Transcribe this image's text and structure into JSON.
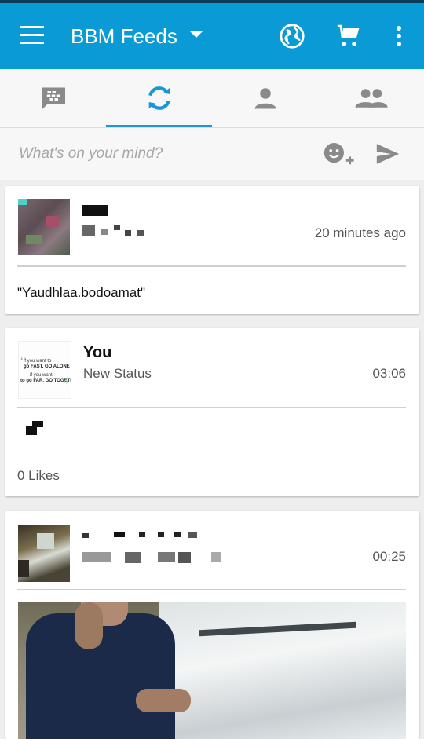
{
  "app": {
    "title": "BBM Feeds"
  },
  "composer": {
    "placeholder": "What's on your mind?"
  },
  "posts": [
    {
      "time": "20 minutes ago",
      "text": "\"Yaudhlaa.bodoamat\""
    },
    {
      "name": "You",
      "subtitle": "New Status",
      "time": "03:06",
      "likes": "0 Likes"
    },
    {
      "time": "00:25"
    }
  ],
  "colors": {
    "appbar": "#0a9ad6",
    "accent": "#1998d5",
    "icon_gray": "#8a8a8a"
  },
  "icons": {
    "menu": "hamburger-icon",
    "dropdown": "caret-down-icon",
    "globe": "globe-icon",
    "cart": "cart-icon",
    "more": "more-vertical-icon",
    "chat": "bbm-chat-icon",
    "updates": "refresh-icon",
    "contact": "person-icon",
    "groups": "groups-icon",
    "emoticon": "emoticon-add-icon",
    "send": "send-icon"
  }
}
